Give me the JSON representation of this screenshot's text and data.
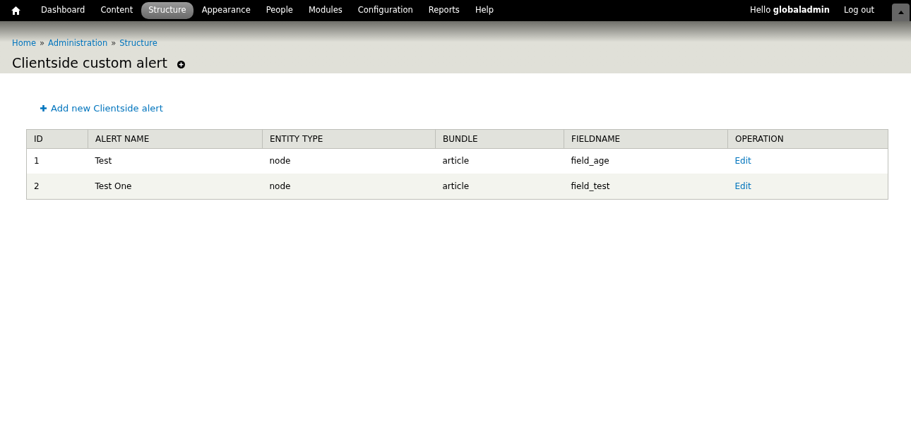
{
  "toolbar": {
    "menu": [
      {
        "label": "Dashboard",
        "selected": false
      },
      {
        "label": "Content",
        "selected": false
      },
      {
        "label": "Structure",
        "selected": true
      },
      {
        "label": "Appearance",
        "selected": false
      },
      {
        "label": "People",
        "selected": false
      },
      {
        "label": "Modules",
        "selected": false
      },
      {
        "label": "Configuration",
        "selected": false
      },
      {
        "label": "Reports",
        "selected": false
      },
      {
        "label": "Help",
        "selected": false
      }
    ],
    "greeting": "Hello **globaladmin**",
    "logout": "Log out"
  },
  "breadcrumb": [
    "Home",
    "Administration",
    "Structure"
  ],
  "breadcrumb_separator": "»",
  "page_title": "Clientside custom alert",
  "add_link": "Add new Clientside alert",
  "table": {
    "columns": [
      "ID",
      "ALERT NAME",
      "ENTITY TYPE",
      "BUNDLE",
      "FIELDNAME",
      "OPERATION"
    ],
    "rows": [
      [
        "1",
        "Test",
        "node",
        "article",
        "field_age",
        "Edit"
      ],
      [
        "2",
        "Test One",
        "node",
        "article",
        "field_test",
        "Edit"
      ]
    ]
  }
}
